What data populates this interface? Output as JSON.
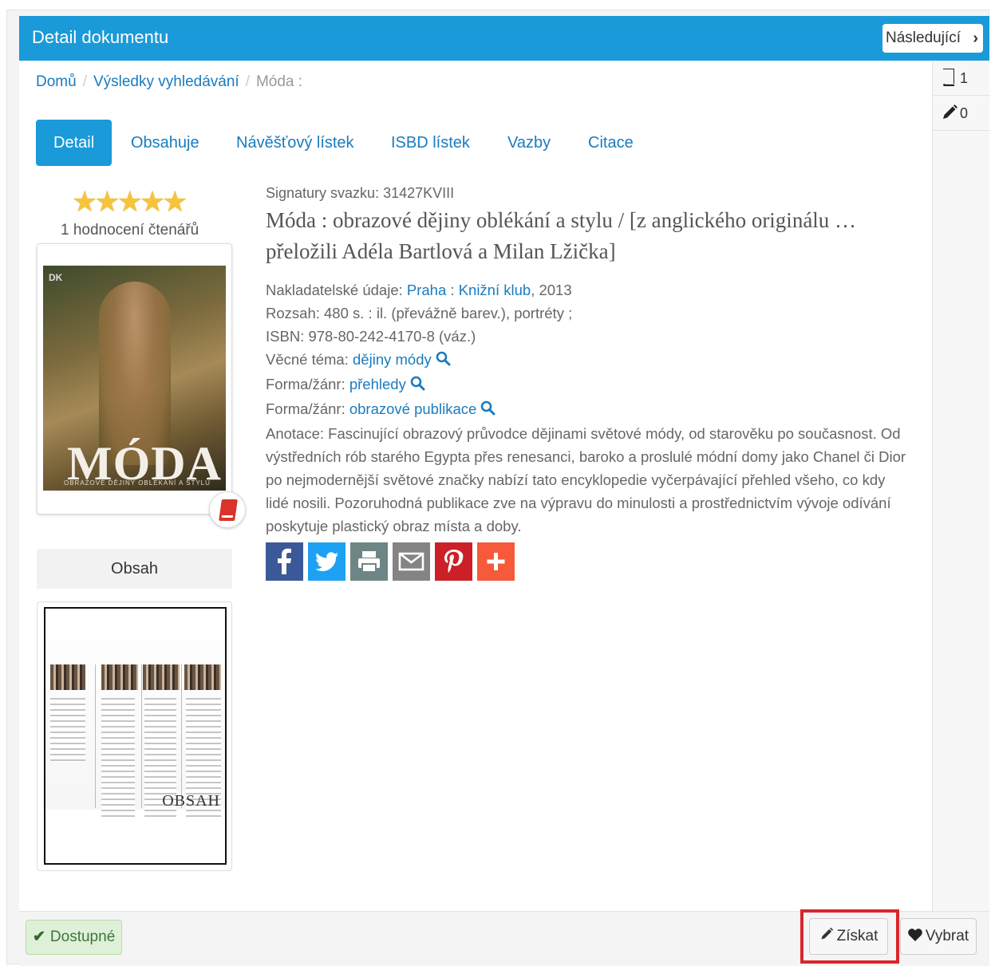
{
  "header": {
    "title": "Detail dokumentu",
    "next_label": "Následující"
  },
  "sidebar": {
    "books_count": "1",
    "notes_count": "0"
  },
  "breadcrumb": {
    "home": "Domů",
    "results": "Výsledky vyhledávání",
    "current": "Móda :"
  },
  "tabs": [
    "Detail",
    "Obsahuje",
    "Návěšťový lístek",
    "ISBD lístek",
    "Vazby",
    "Citace"
  ],
  "rating": {
    "stars": 5,
    "max": 5,
    "count_label": "1 hodnocení čtenářů"
  },
  "cover": {
    "publisher_logo": "DK",
    "title": "MÓDA",
    "subtitle": "OBRAZOVÉ DĚJINY OBLÉKÁNÍ A STYLU"
  },
  "contents": {
    "button_label": "Obsah",
    "thumb_label": "OBSAH"
  },
  "document": {
    "signature_label": "Signatury svazku:",
    "signature_value": "31427KVIII",
    "title": "Móda : obrazové dějiny oblékání a stylu / [z anglického originálu … přeložili Adéla Bartlová a Milan Lžička]",
    "publisher_label": "Nakladatelské údaje:",
    "publisher_place": "Praha",
    "publisher_name": "Knižní klub",
    "publisher_year": ", 2013",
    "extent_label": "Rozsah:",
    "extent_value": "480 s. : il. (převážně barev.), portréty ;",
    "isbn_label": "ISBN:",
    "isbn_value": "978-80-242-4170-8 (váz.)",
    "subject_label": "Věcné téma:",
    "subject_value": "dějiny módy",
    "genre_label": "Forma/žánr:",
    "genre_value_1": "přehledy",
    "genre_value_2": "obrazové publikace",
    "annotation_label": "Anotace:",
    "annotation_value": "Fascinující obrazový průvodce dějinami světové módy, od starověku po současnost. Od výstředních rób starého Egypta přes renesanci, baroko a proslulé módní domy jako Chanel či Dior po nejmodernější světové značky nabízí tato encyklopedie vyčerpávající přehled všeho, co kdy lidé nosili. Pozoruhodná publikace zve na výpravu do minulosti a prostřednictvím vývoje odívání poskytuje plastický obraz místa a doby."
  },
  "share": [
    {
      "icon": "facebook-icon",
      "color": "#3b5998"
    },
    {
      "icon": "twitter-icon",
      "color": "#1da1f2"
    },
    {
      "icon": "print-icon",
      "color": "#6d8585"
    },
    {
      "icon": "email-icon",
      "color": "#848484"
    },
    {
      "icon": "pinterest-icon",
      "color": "#cb2027"
    },
    {
      "icon": "more-icon",
      "color": "#f65a3b"
    }
  ],
  "footer": {
    "status_label": "Dostupné",
    "get_label": "Získat",
    "select_label": "Vybrat"
  },
  "colors": {
    "accent": "#1a9ad8",
    "link": "#1a7bbf",
    "highlight": "#d9262c",
    "status_bg": "#dff0d8"
  }
}
